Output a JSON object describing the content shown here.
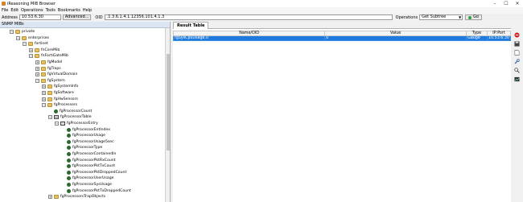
{
  "window": {
    "title": "iReasoning MIB Browser",
    "controls": [
      "–",
      "☐",
      "✕"
    ]
  },
  "menu": [
    "File",
    "Edit",
    "Operations",
    "Tools",
    "Bookmarks",
    "Help"
  ],
  "toolbar": {
    "address_label": "Address",
    "address_value": "10.53.6.30",
    "advanced_label": "Advanced...",
    "oid_label": "OID",
    "oid_value": ".1.3.6.1.4.1.12356.101.4.1.3",
    "operations_label": "Operations",
    "operations_value": "Get Subtree",
    "go_label": "Go"
  },
  "left_panel": {
    "header": "SNMP MIBs",
    "tree": [
      {
        "label": "private",
        "depth": 1,
        "icon": "folder",
        "expander": "−"
      },
      {
        "label": "enterprises",
        "depth": 2,
        "icon": "folder",
        "expander": "−"
      },
      {
        "label": "fortinet",
        "depth": 3,
        "icon": "folder",
        "expander": "−"
      },
      {
        "label": "fnCoreMib",
        "depth": 4,
        "icon": "folder",
        "expander": "+"
      },
      {
        "label": "fnFortiGateMib",
        "depth": 4,
        "icon": "folder",
        "expander": "−"
      },
      {
        "label": "fgModel",
        "depth": 5,
        "icon": "folder",
        "expander": "+"
      },
      {
        "label": "fgTraps",
        "depth": 5,
        "icon": "folder",
        "expander": "+"
      },
      {
        "label": "fgVirtualDomain",
        "depth": 5,
        "icon": "folder",
        "expander": "+"
      },
      {
        "label": "fgSystem",
        "depth": 5,
        "icon": "folder",
        "expander": "−"
      },
      {
        "label": "fgSystemInfo",
        "depth": 6,
        "icon": "folder",
        "expander": "+"
      },
      {
        "label": "fgSoftware",
        "depth": 6,
        "icon": "folder",
        "expander": "+"
      },
      {
        "label": "fgHwSensors",
        "depth": 6,
        "icon": "folder",
        "expander": "+"
      },
      {
        "label": "fgProcessors",
        "depth": 6,
        "icon": "folder",
        "expander": "−"
      },
      {
        "label": "fgProcessorCount",
        "depth": 7,
        "icon": "leaf",
        "expander": ""
      },
      {
        "label": "fgProcessorTable",
        "depth": 7,
        "icon": "table",
        "expander": "−"
      },
      {
        "label": "fgProcessorEntry",
        "depth": 8,
        "icon": "entry",
        "expander": "−"
      },
      {
        "label": "fgProcessorEntIndex",
        "depth": 9,
        "icon": "leaf",
        "expander": ""
      },
      {
        "label": "fgProcessorUsage",
        "depth": 9,
        "icon": "leaf",
        "expander": ""
      },
      {
        "label": "fgProcessorUsage5sec",
        "depth": 9,
        "icon": "leaf",
        "expander": ""
      },
      {
        "label": "fgProcessorType",
        "depth": 9,
        "icon": "leaf",
        "expander": ""
      },
      {
        "label": "fgProcessorContainedIn",
        "depth": 9,
        "icon": "leaf",
        "expander": ""
      },
      {
        "label": "fgProcessorPktRxCount",
        "depth": 9,
        "icon": "leaf",
        "expander": ""
      },
      {
        "label": "fgProcessorPktTxCount",
        "depth": 9,
        "icon": "leaf",
        "expander": ""
      },
      {
        "label": "fgProcessorPktDroppedCount",
        "depth": 9,
        "icon": "leaf",
        "expander": ""
      },
      {
        "label": "fgProcessorUserUsage",
        "depth": 9,
        "icon": "leaf",
        "expander": ""
      },
      {
        "label": "fgProcessorSysUsage",
        "depth": 9,
        "icon": "leaf",
        "expander": ""
      },
      {
        "label": "fgProcessorPktTxDroppedCount",
        "depth": 9,
        "icon": "leaf",
        "expander": ""
      },
      {
        "label": "fgProcessorsTrapObjects",
        "depth": 7,
        "icon": "folder",
        "expander": "+"
      }
    ]
  },
  "result_tab": {
    "label": "Result Table",
    "columns": [
      "Name/OID",
      "Value",
      "Type",
      "IP:Port"
    ],
    "rows": [
      {
        "name": "fgSysCpuUsage.0",
        "value": "0",
        "type": "Gauge",
        "ipport": "10.53.6.30"
      }
    ]
  },
  "side_icons": [
    "stop-icon",
    "save-icon",
    "document-icon",
    "wrench-icon",
    "find-icon",
    "chart-icon"
  ],
  "colors": {
    "selection": "#1f7ae0",
    "header": "#dce6f2"
  }
}
